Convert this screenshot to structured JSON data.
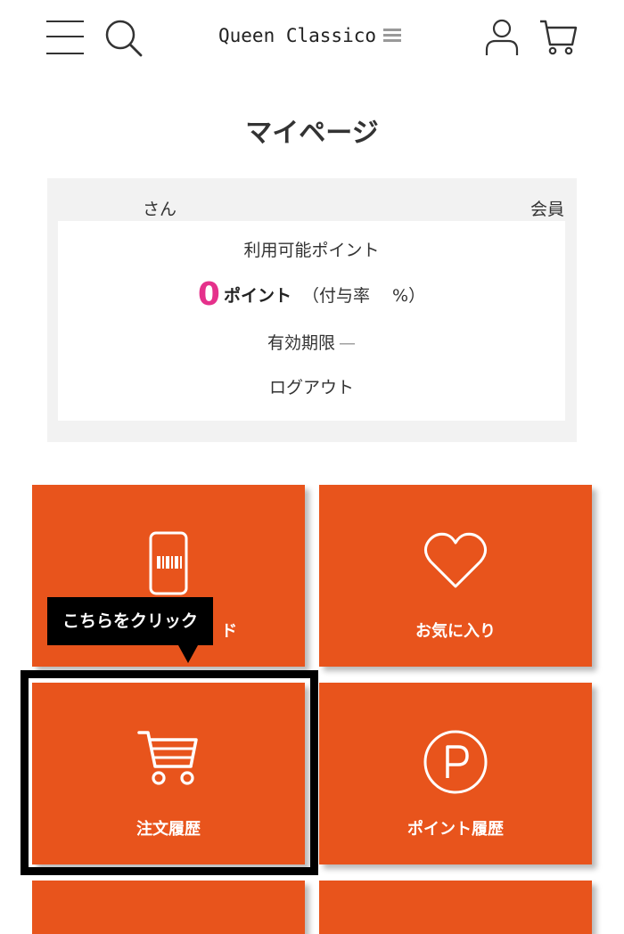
{
  "header": {
    "logo_text": "Queen Classico",
    "icons": {
      "menu": "hamburger-icon",
      "search": "search-icon",
      "user": "user-icon",
      "cart": "cart-icon"
    }
  },
  "page": {
    "title": "マイページ"
  },
  "member": {
    "name_suffix": "さん",
    "rank_label": "会員",
    "points_label": "利用可能ポイント",
    "points_value": "0",
    "points_unit": "ポイント",
    "points_rate": "（付与率　  %）",
    "expiry_label": "有効期限",
    "expiry_value": "—",
    "logout_label": "ログアウト"
  },
  "tiles": [
    {
      "label": "ド",
      "icon": "member-card-icon"
    },
    {
      "label": "お気に入り",
      "icon": "heart-icon"
    },
    {
      "label": "注文履歴",
      "icon": "cart-icon"
    },
    {
      "label": "ポイント履歴",
      "icon": "point-p-icon"
    }
  ],
  "tooltip": {
    "text": "こちらをクリック"
  },
  "colors": {
    "tile_orange": "#e8541c",
    "points_pink": "#e5318b",
    "panel_gray": "#f2f2f2",
    "highlight_black": "#000000"
  }
}
